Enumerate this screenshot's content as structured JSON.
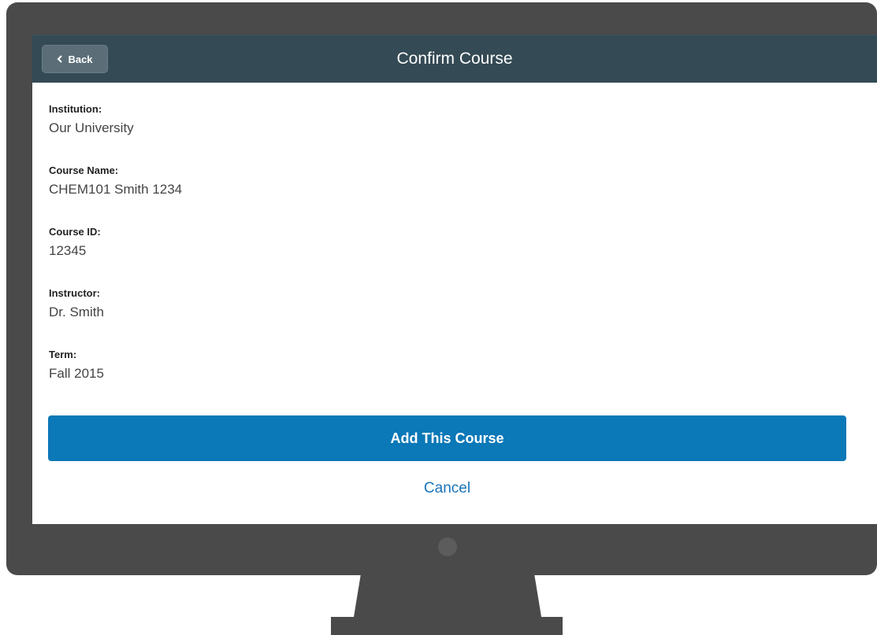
{
  "header": {
    "back_label": "Back",
    "title": "Confirm Course"
  },
  "fields": [
    {
      "label": "Institution:",
      "value": "Our University"
    },
    {
      "label": "Course Name:",
      "value": "CHEM101 Smith 1234"
    },
    {
      "label": "Course ID:",
      "value": "12345"
    },
    {
      "label": "Instructor:",
      "value": "Dr. Smith"
    },
    {
      "label": "Term:",
      "value": "Fall 2015"
    }
  ],
  "actions": {
    "add_label": "Add This Course",
    "cancel_label": "Cancel"
  },
  "colors": {
    "navbar": "#344a55",
    "primary_button": "#0b78b7",
    "link": "#1a74b8",
    "bezel": "#4a4a4a"
  },
  "icons": {
    "back": "chevron-left-icon"
  }
}
